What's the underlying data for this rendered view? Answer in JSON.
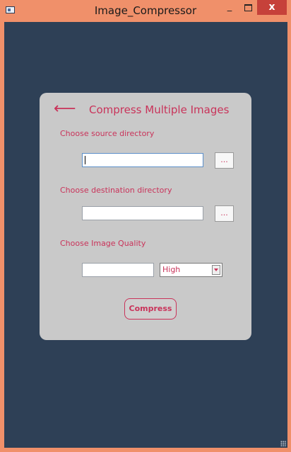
{
  "window": {
    "title": "Image_Compressor",
    "controls": {
      "minimize": "_",
      "close": "x"
    }
  },
  "card": {
    "back_arrow": "⟵",
    "title": "Compress Multiple Images",
    "source_label": "Choose source directory",
    "source_value": "",
    "source_browse": "...",
    "destination_label": "Choose destination directory",
    "destination_value": "",
    "destination_browse": "...",
    "quality_label": "Choose Image Quality",
    "quality_value": "",
    "quality_selected": "High",
    "compress_label": "Compress"
  },
  "colors": {
    "titlebar": "#f0906a",
    "background": "#2e4056",
    "card": "#c9c9c9",
    "accent": "#c9335a",
    "close": "#c6413a"
  }
}
